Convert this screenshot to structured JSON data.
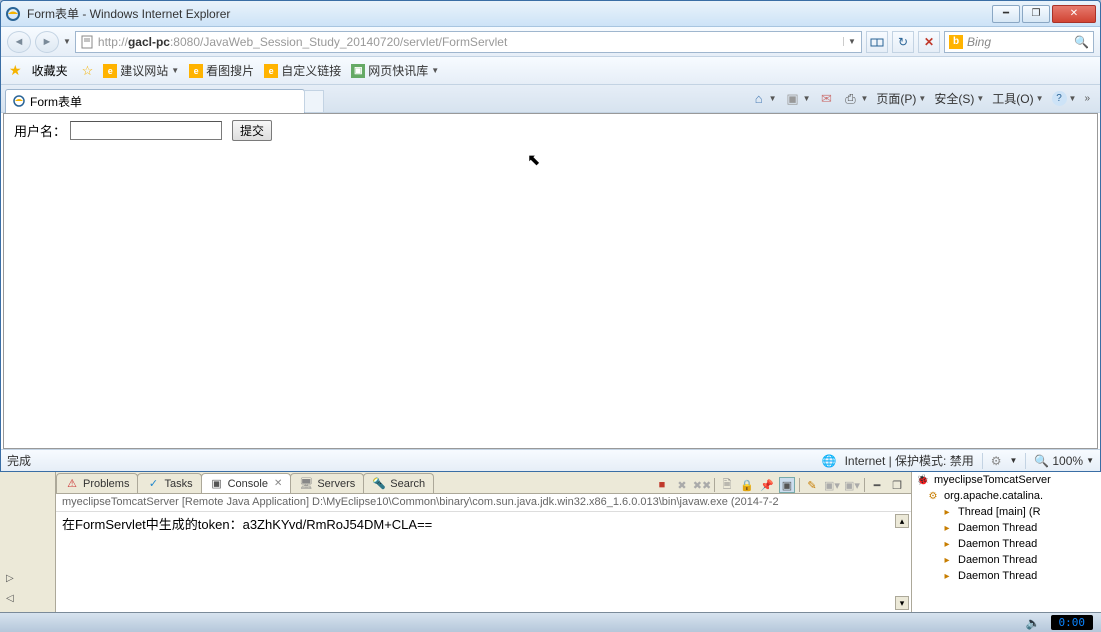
{
  "window": {
    "title": "Form表单 - Windows Internet Explorer"
  },
  "address": {
    "prefix": "http://",
    "host": "gacl-pc",
    "port": ":8080",
    "path": "/JavaWeb_Session_Study_20140720/servlet/FormServlet"
  },
  "search": {
    "engine": "Bing"
  },
  "favbar": {
    "favorites": "收藏夹",
    "items": [
      "建议网站",
      "看图搜片",
      "自定义链接",
      "网页快讯库"
    ]
  },
  "tab": {
    "title": "Form表单"
  },
  "commandbar": {
    "page": "页面(P)",
    "safety": "安全(S)",
    "tools": "工具(O)"
  },
  "form": {
    "label": "用户名：",
    "submit": "提交"
  },
  "statusbar": {
    "done": "完成",
    "zone": "Internet | 保护模式: 禁用",
    "zoom": "100%"
  },
  "eclipse": {
    "tabs": {
      "problems": "Problems",
      "tasks": "Tasks",
      "console": "Console",
      "servers": "Servers",
      "search": "Search"
    },
    "console_sub": "myeclipseTomcatServer [Remote Java Application] D:\\MyEclipse10\\Common\\binary\\com.sun.java.jdk.win32.x86_1.6.0.013\\bin\\javaw.exe (2014-7-2",
    "output": "在FormServlet中生成的token：a3ZhKYvd/RmRoJ54DM+CLA==",
    "debug": {
      "root": "myeclipseTomcatServer",
      "app": "org.apache.catalina.",
      "threads": [
        "Thread [main] (R",
        "Daemon Thread",
        "Daemon Thread",
        "Daemon Thread",
        "Daemon Thread"
      ]
    }
  },
  "clock": "0:00"
}
